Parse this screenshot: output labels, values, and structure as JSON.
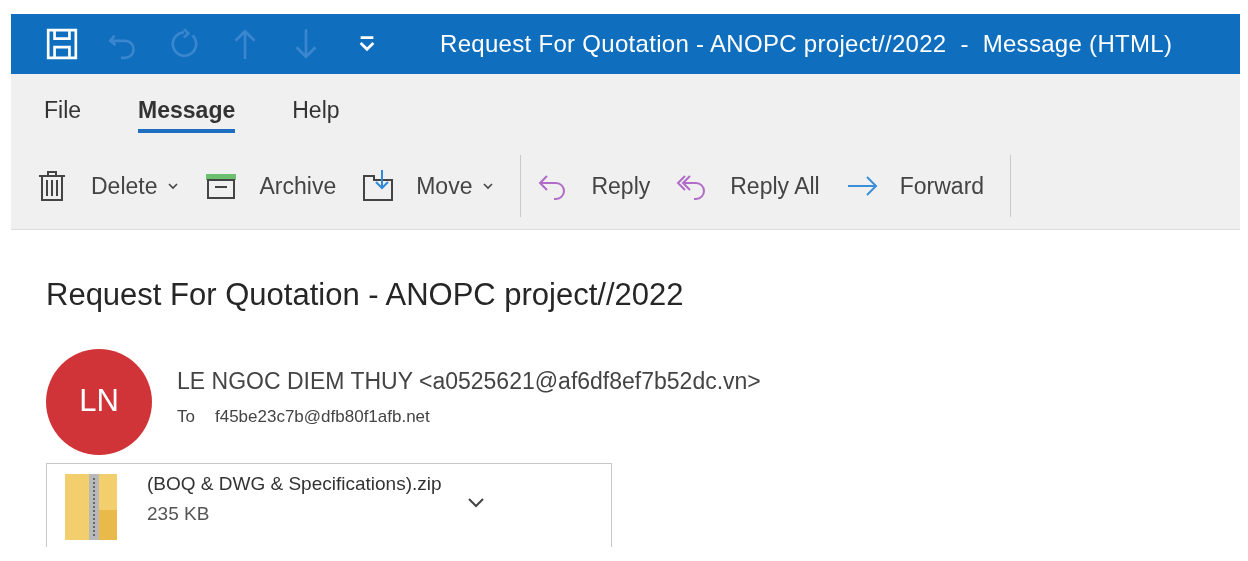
{
  "window": {
    "title": "Request For Quotation - ANOPC project//2022  -  Message (HTML)"
  },
  "quick_access": [
    {
      "kind": "save",
      "disabled": false
    },
    {
      "kind": "undo",
      "disabled": true
    },
    {
      "kind": "redo",
      "disabled": true
    },
    {
      "kind": "up",
      "disabled": true
    },
    {
      "kind": "down",
      "disabled": true
    },
    {
      "kind": "customize",
      "disabled": false
    }
  ],
  "tabs": [
    {
      "label": "File",
      "selected": false
    },
    {
      "label": "Message",
      "selected": true
    },
    {
      "label": "Help",
      "selected": false
    }
  ],
  "toolbar_groups": [
    {
      "items": [
        {
          "kind": "delete",
          "label": "Delete",
          "dropdown": true
        },
        {
          "kind": "archive",
          "label": "Archive",
          "dropdown": false
        },
        {
          "kind": "move",
          "label": "Move",
          "dropdown": true
        }
      ]
    },
    {
      "items": [
        {
          "kind": "reply",
          "label": "Reply",
          "dropdown": false
        },
        {
          "kind": "reply_all",
          "label": "Reply All",
          "dropdown": false
        },
        {
          "kind": "forward",
          "label": "Forward",
          "dropdown": false
        }
      ]
    }
  ],
  "message": {
    "subject": "Request For Quotation - ANOPC project//2022",
    "avatar": {
      "initials": "LN",
      "color": "#d13438"
    },
    "sender": "LE NGOC DIEM THUY <a0525621@af6df8ef7b52dc.vn>",
    "to_label": "To",
    "to": "f45be23c7b@dfb80f1afb.net",
    "attachment": {
      "name": "(BOQ & DWG & Specifications).zip",
      "size": "235 KB"
    }
  }
}
